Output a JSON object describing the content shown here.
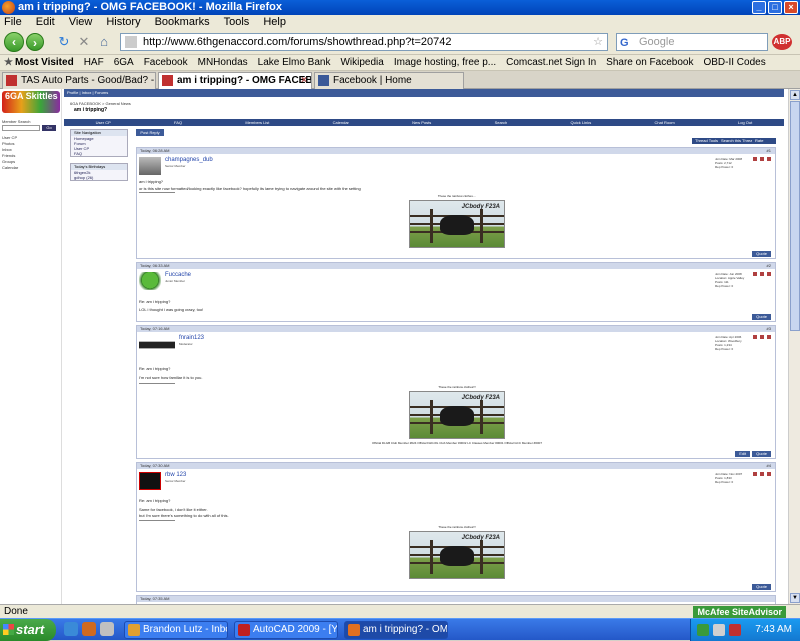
{
  "window": {
    "title": "am i tripping? - OMG FACEBOOK! - Mozilla Firefox",
    "controls": [
      "_",
      "□",
      "×"
    ]
  },
  "menu": [
    "File",
    "Edit",
    "View",
    "History",
    "Bookmarks",
    "Tools",
    "Help"
  ],
  "nav": {
    "url": "http://www.6thgenaccord.com/forums/showthread.php?t=20742",
    "search_placeholder": "Google",
    "search_engine": "G",
    "adblock": "ABP"
  },
  "bookmarks": [
    "Most Visited",
    "HAF",
    "6GA",
    "Facebook",
    "MNHondas",
    "Lake Elmo Bank",
    "Wikipedia",
    "Image hosting, free p...",
    "Comcast.net Sign In",
    "Share on Facebook",
    "OBD-II Codes"
  ],
  "tabs": [
    {
      "label": "TAS Auto Parts - Good/Bad? - Honda A...",
      "active": false
    },
    {
      "label": "am i tripping? - OMG FACEBOOK!",
      "active": true
    },
    {
      "label": "Facebook | Home",
      "active": false
    }
  ],
  "forum": {
    "logo": "6GA Skittles",
    "top_links": "Profile | Inbox | Forums",
    "breadcrumb": "6GA FACEBOOK > General News",
    "thread_title": "am i tripping?",
    "nav_items": [
      "User CP",
      "FAQ",
      "Members List",
      "Calendar",
      "New Posts",
      "Search",
      "Quick Links",
      "Chat Room",
      "Log Out"
    ],
    "sidebar_member_search": "Member Search",
    "sidebar_search_go": "Go",
    "sidebar_links": [
      "User CP",
      "Photos",
      "Inbox",
      "Friends",
      "Groups",
      "Calendar"
    ],
    "site_navigation": {
      "title": "Site Navigation",
      "links": [
        "Homepage",
        "Forum",
        "User CP",
        "FAQ"
      ]
    },
    "birthdays": {
      "title": "Today's Birthdays",
      "names": [
        "6thgen2k",
        "gdhop (26)"
      ]
    },
    "post_reply": "Post Reply",
    "thread_tools": "Thread Tools",
    "search_thread": "Search this Thread",
    "rate_thread": "Rate Thread"
  },
  "posts": [
    {
      "date": "Today, 06:28 AM",
      "num": "#1",
      "user": "champagnes_dub",
      "title": "Senior Member",
      "info": [
        "Join Date: Mar 2008",
        "Posts: 2,712",
        "Rep Power: 0"
      ],
      "subject": "am i tripping?",
      "text": "or is this site now formatted/looking exactly like facebook? hopefully its lame trying to navigate around the site with the setting",
      "sig_title": "These the rainbow clothes....",
      "sig_tag": "JCbody F23A",
      "buttons": [
        "Quote"
      ]
    },
    {
      "date": "Today, 06:33 AM",
      "num": "#2",
      "user": "Fuccache",
      "title": "Junior Member",
      "info": [
        "Join Date: Jun 2008",
        "Location: Apple Valley",
        "Posts: 111",
        "Rep Power: 0"
      ],
      "subject": "Re: am i tripping?",
      "text": "LOL i thought i was going crazy, too!",
      "buttons": [
        "Quote"
      ]
    },
    {
      "date": "Today, 07:16 AM",
      "num": "#3",
      "user": "fnrain123",
      "title": "Moderator",
      "info": [
        "Join Date: Apr 2006",
        "Location: Woodbury",
        "Posts: 1,234",
        "Rep Power: 0"
      ],
      "subject": "Re: am i tripping?",
      "text": "I'm not sure how familiar it is to you.",
      "sig_title": "These the rainbow clothes!!!",
      "sig_tag": "JCbody F23A",
      "sig_caption": "Official DLGB Club Member #024  Official FHD-6G Club Member #0032  LC Classes Member #0001  Official GCC Member #0007",
      "buttons": [
        "Edit",
        "Quote"
      ]
    },
    {
      "date": "Today, 07:30 AM",
      "num": "#4",
      "user": "rbw 123",
      "title": "Senior Member",
      "info": [
        "Join Date: Nov 2007",
        "Posts: 1,833",
        "Rep Power: 0"
      ],
      "subject": "Re: am i tripping?",
      "text": "Same for facebook, i don't like it either.",
      "text2": "but I'm sure there's something to do with all of this.",
      "sig_title": "These the rainbow clothes!!!",
      "sig_tag": "JCbody F23A",
      "buttons": [
        "Quote"
      ]
    }
  ],
  "next_date": "Today, 07:35 AM",
  "status": {
    "text": "Done",
    "mcafee": "McAfee SiteAdvisor"
  },
  "taskbar": {
    "start": "start",
    "tasks": [
      {
        "label": "Brandon Lutz - Inbox ...",
        "active": false
      },
      {
        "label": "AutoCAD 2009 - [Y:\\...",
        "active": false
      },
      {
        "label": "am i tripping? - OMG ...",
        "active": true
      }
    ],
    "clock": "7:43 AM"
  }
}
